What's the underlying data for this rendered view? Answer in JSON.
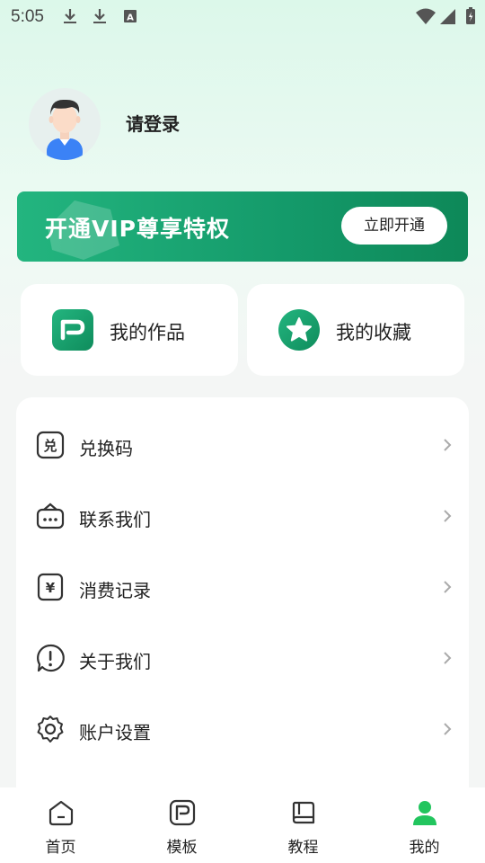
{
  "status_bar": {
    "time": "5:05",
    "icons": [
      "download-icon",
      "download-icon",
      "keyboard-a-icon",
      "wifi-icon",
      "signal-icon",
      "battery-charging-icon"
    ]
  },
  "profile": {
    "login_text": "请登录",
    "avatar_icon": "user-avatar-icon"
  },
  "vip": {
    "title": "开通VIP尊享特权",
    "button_label": "立即开通",
    "colors": {
      "start": "#23b57f",
      "end": "#0e8858"
    }
  },
  "cards": [
    {
      "label": "我的作品",
      "icon": "works-p-icon"
    },
    {
      "label": "我的收藏",
      "icon": "star-icon"
    }
  ],
  "menu": {
    "items": [
      {
        "label": "兑换码",
        "icon": "redeem-code-icon"
      },
      {
        "label": "联系我们",
        "icon": "contact-icon"
      },
      {
        "label": "消费记录",
        "icon": "yuan-record-icon"
      },
      {
        "label": "关于我们",
        "icon": "info-icon"
      },
      {
        "label": "账户设置",
        "icon": "settings-icon"
      }
    ]
  },
  "bottom_nav": {
    "active_index": 3,
    "active_color": "#22c55e",
    "items": [
      {
        "label": "首页",
        "icon": "home-icon"
      },
      {
        "label": "模板",
        "icon": "template-icon"
      },
      {
        "label": "教程",
        "icon": "book-icon"
      },
      {
        "label": "我的",
        "icon": "user-icon"
      }
    ]
  }
}
